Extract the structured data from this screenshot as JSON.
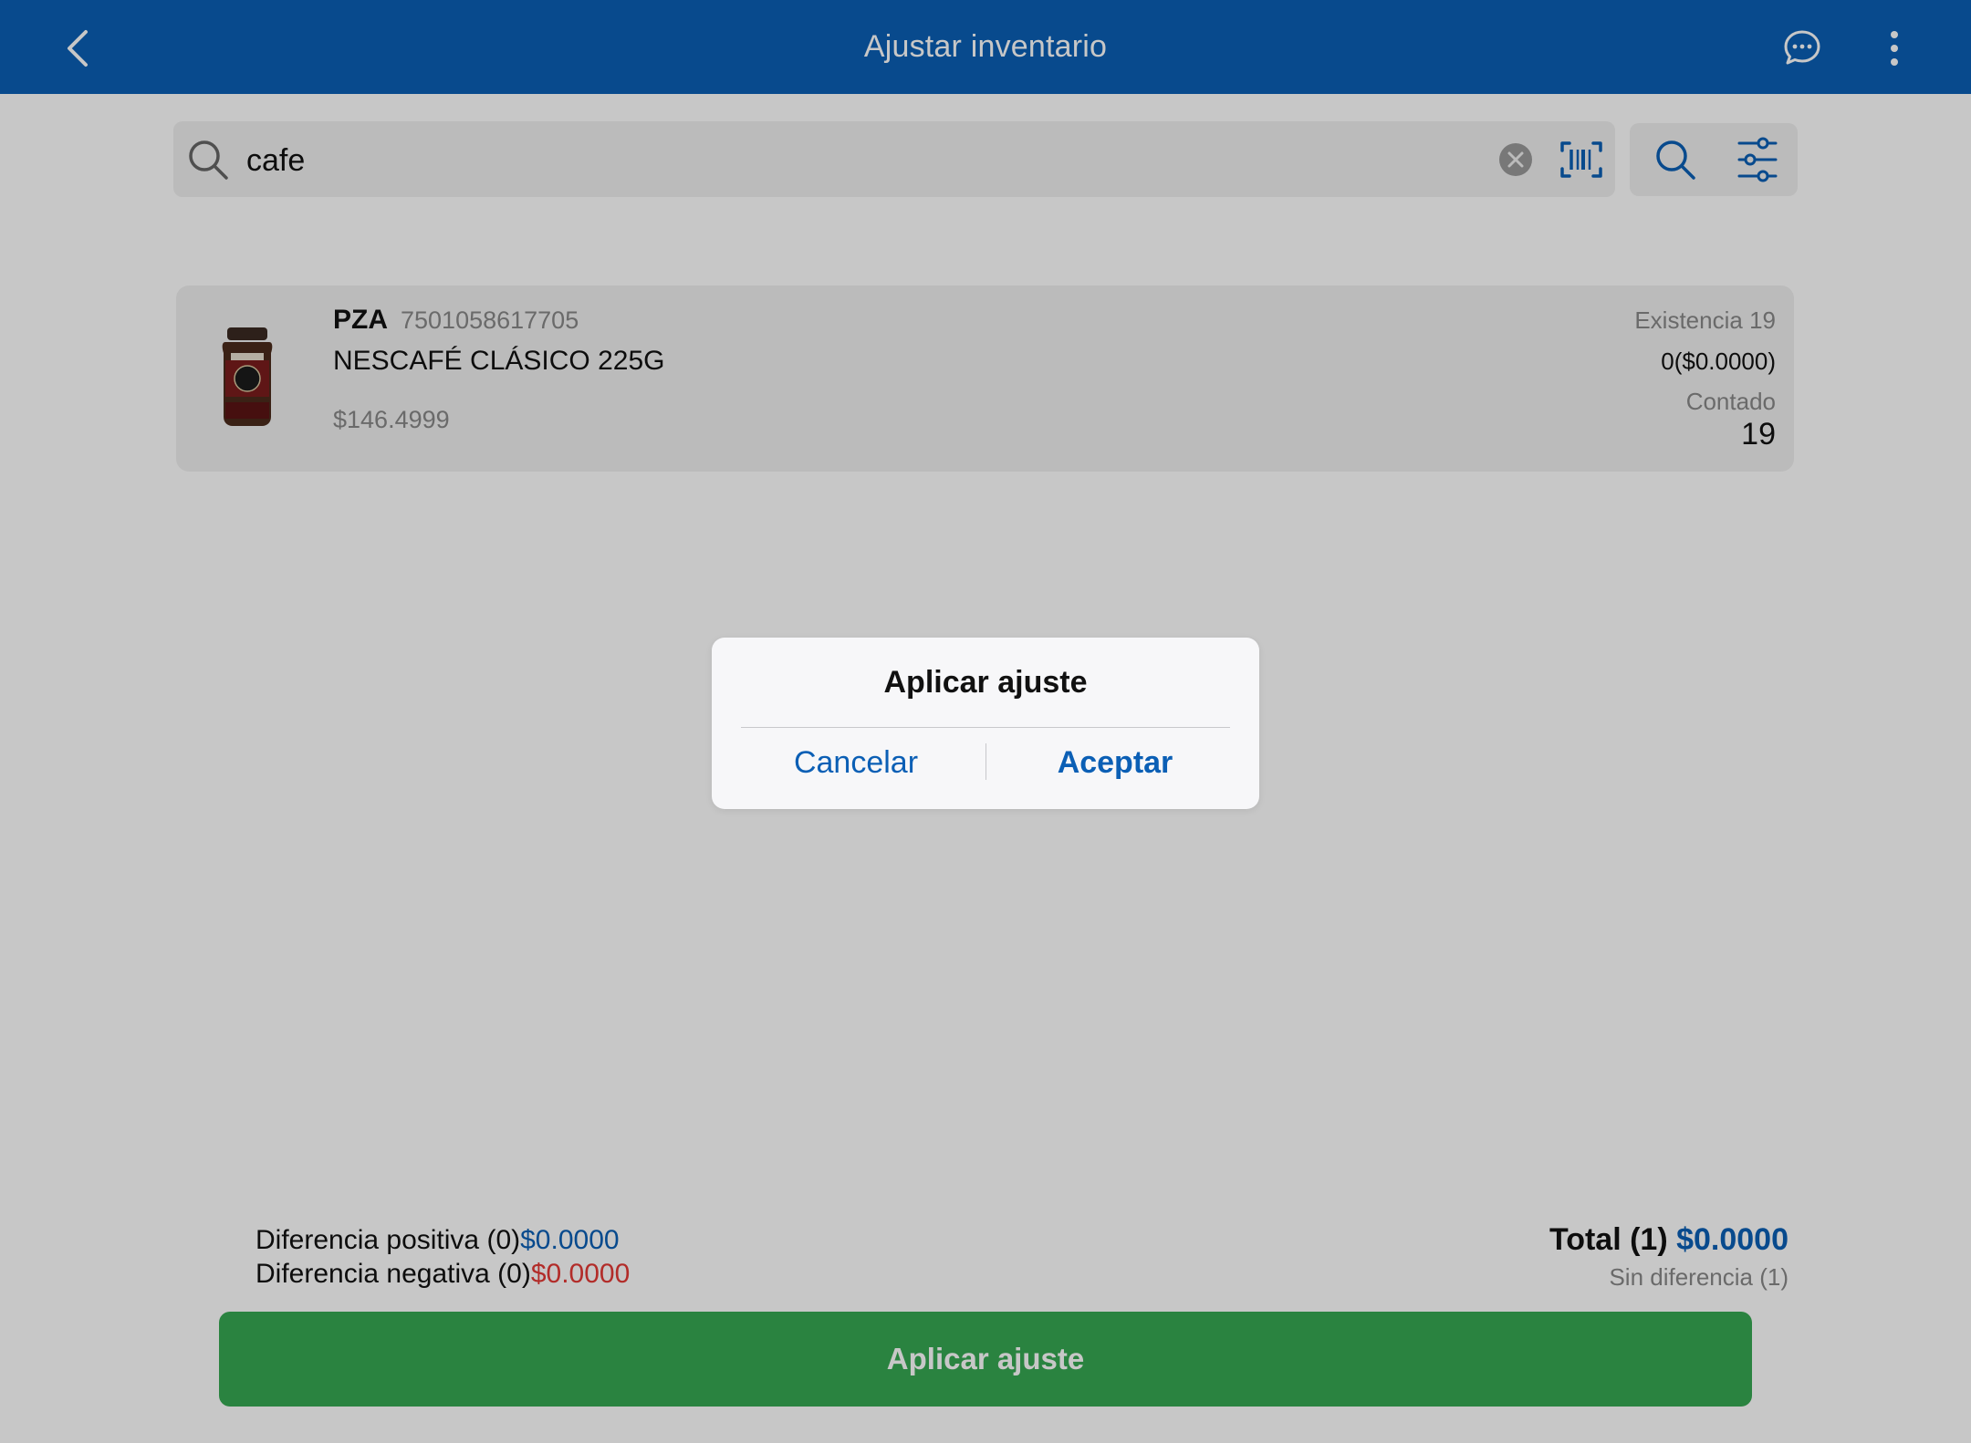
{
  "header": {
    "title": "Ajustar inventario",
    "back_icon": "chevron-left-icon",
    "chat_icon": "chat-bubble-icon",
    "more_icon": "vertical-ellipsis-icon"
  },
  "search": {
    "value": "cafe",
    "placeholder": "",
    "clear_icon": "clear-circle-icon",
    "barcode_icon": "barcode-scan-icon"
  },
  "toolbar": {
    "search_icon": "search-icon",
    "filter_icon": "sliders-filter-icon"
  },
  "products": [
    {
      "unit": "PZA",
      "barcode": "7501058617705",
      "name": "NESCAFÉ CLÁSICO 225G",
      "price": "$146.4999",
      "stock": "Existencia 19",
      "difference": "0($0.0000)",
      "counted_label": "Contado",
      "counted": "19"
    }
  ],
  "summary": {
    "positive_label": "Diferencia positiva (0)",
    "positive_value": "$0.0000",
    "negative_label": "Diferencia negativa (0)",
    "negative_value": "$0.0000",
    "total_label": "Total (1) ",
    "total_value": "$0.0000",
    "no_difference": "Sin diferencia (1)"
  },
  "apply_button": "Aplicar ajuste",
  "dialog": {
    "title": "Aplicar ajuste",
    "cancel": "Cancelar",
    "accept": "Aceptar"
  },
  "colors": {
    "brand": "#0b5fb5",
    "apply_green": "#37a852",
    "negative_red": "#e53935"
  }
}
